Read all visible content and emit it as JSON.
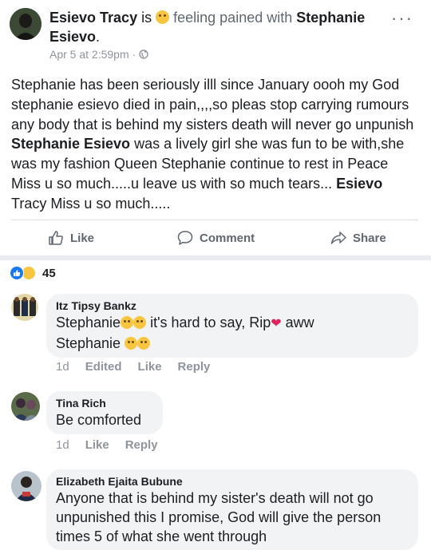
{
  "post": {
    "author": "Esievo Tracy",
    "is_word": "is",
    "feeling_text": "feeling pained with",
    "tagged": "Stephanie",
    "tagged_line2": "Esievo",
    "period": ".",
    "timestamp": "Apr 5 at 2:59pm",
    "dot": "·",
    "body": {
      "part1": "Stephanie has been seriously illl since January oooh my God stephanie esievo died in pain,,,,so pleas stop carrying rumours any body that is behind my sisters death will never go unpunish ",
      "bold1": "Stephanie Esievo",
      "part2": " was a lively girl she was fun to be with,she was my fashion Queen Stephanie continue to rest  in Peace Miss u so much.....u leave us with so much tears... ",
      "bold2": "Esievo",
      "part3": " Tracy Miss u so much....."
    },
    "menu": "···",
    "actions": {
      "like": "Like",
      "comment": "Comment",
      "share": "Share"
    }
  },
  "reactions": {
    "count": "45"
  },
  "comments": [
    {
      "name": "Itz Tipsy Bankz",
      "line1_a": "Stephanie",
      "line1_b": " it's hard to say, Rip",
      "line1_c": " aww",
      "line2": "Stephanie ",
      "age": "1d",
      "edited": "Edited",
      "like": "Like",
      "reply": "Reply"
    },
    {
      "name": "Tina Rich",
      "text": "Be comforted",
      "age": "1d",
      "like": "Like",
      "reply": "Reply"
    },
    {
      "name": "Elizabeth Ejaita Bubune",
      "text": "Anyone that is behind my sister's death will not go unpunished this I promise, God will give the person times 5 of what she went through"
    }
  ],
  "colors": {
    "link_blue": "#1877f2",
    "secondary_text": "#90949c",
    "bubble_bg": "#f2f3f5"
  }
}
